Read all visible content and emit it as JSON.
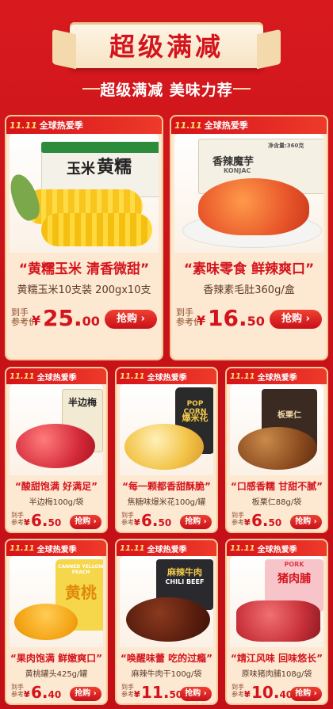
{
  "banner": {
    "title": "超级满减",
    "subtitle": "超级满减 美味力荐"
  },
  "tag": {
    "t11": "11.11",
    "label": "全球热爱季"
  },
  "price_label": "到手\n参考价",
  "buy_label": "抢购",
  "products": [
    {
      "slogan": "“黄糯玉米 清香微甜”",
      "name": "黄糯玉米10支装 200gx10支",
      "price_int": "25.",
      "price_dec": "00",
      "pack_text": "玉米",
      "pack_text2": "黄糯"
    },
    {
      "slogan": "“素味零食 鲜辣爽口”",
      "name": "香辣素毛肚360g/盒",
      "price_int": "16.",
      "price_dec": "50",
      "pack_text": "香辣魔芋",
      "pack_text2": "KONJAC",
      "pack_text3": "净含量:360克"
    },
    {
      "slogan": "“酸甜饱满 好满足”",
      "name": "半边梅100g/袋",
      "price_int": "6.",
      "price_dec": "50",
      "pack_text": "半边梅"
    },
    {
      "slogan": "“每一颗都香甜酥脆”",
      "name": "焦糖味爆米花100g/罐",
      "price_int": "6.",
      "price_dec": "50",
      "pack_text": "POP CORN",
      "pack_text2": "爆米花"
    },
    {
      "slogan": "“口感香糯 甘甜不腻”",
      "name": "板栗仁88g/袋",
      "price_int": "6.",
      "price_dec": "50",
      "pack_text": "板栗仁"
    },
    {
      "slogan": "“果肉饱满 鲜嫩爽口”",
      "name": "黄桃罐头425g/罐",
      "price_int": "6.",
      "price_dec": "40",
      "pack_text": "CANNED YELLOW PEACH",
      "pack_text2": "黄桃"
    },
    {
      "slogan": "“唤醒味蕾 吃的过瘾”",
      "name": "麻辣牛肉干100g/袋",
      "price_int": "11.",
      "price_dec": "50",
      "pack_text": "麻辣牛肉",
      "pack_text2": "CHILI BEEF"
    },
    {
      "slogan": "“靖江风味 回味悠长”",
      "name": "原味猪肉脯108g/袋",
      "price_int": "10.",
      "price_dec": "40",
      "pack_text": "猪肉脯",
      "pack_text2": "PORK"
    }
  ],
  "colors": {
    "brand_red": "#d4141c",
    "card_bg": "#fde8d2",
    "gold": "#f6c991"
  }
}
